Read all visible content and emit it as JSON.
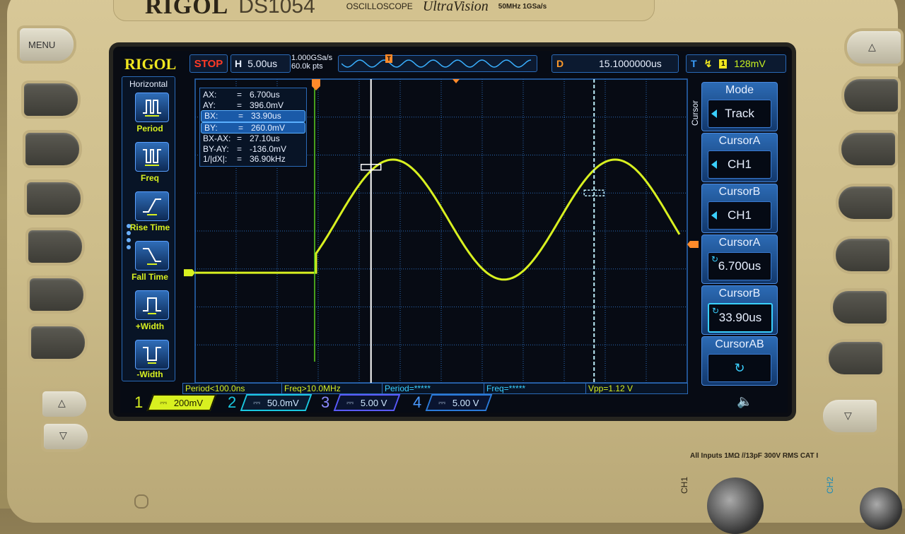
{
  "device": {
    "brand": "RIGOL",
    "model": "DS1054",
    "category_label": "OSCILLOSCOPE",
    "series": "UltraVision",
    "spec": "50MHz  1GSa/s",
    "input_spec": "All Inputs 1MΩ //13pF 300V RMS  CAT I",
    "menu_button_label": "MENU",
    "channel_connectors": [
      "CH1",
      "CH2"
    ]
  },
  "topbar": {
    "logo": "RIGOL",
    "run_state": "STOP",
    "horizontal_label": "H",
    "timebase": "5.00us",
    "sample_rate": "1.000GSa/s",
    "memory_depth": "60.0k pts",
    "trigger_marker": "T",
    "delay_label": "D",
    "delay_value": "15.1000000us",
    "trigger_label": "T",
    "trigger_edge": "rising-edge-icon",
    "trigger_source": "1",
    "trigger_level": "128mV"
  },
  "left_menu": {
    "title": "Horizontal",
    "items": [
      {
        "label": "Period",
        "icon": "period-icon"
      },
      {
        "label": "Freq",
        "icon": "frequency-icon"
      },
      {
        "label": "Rise Time",
        "icon": "rise-time-icon"
      },
      {
        "label": "Fall Time",
        "icon": "fall-time-icon"
      },
      {
        "label": "+Width",
        "icon": "positive-width-icon"
      },
      {
        "label": "-Width",
        "icon": "negative-width-icon"
      }
    ]
  },
  "cursor_readout": [
    {
      "key": "AX:",
      "value": "6.700us",
      "highlight": false
    },
    {
      "key": "AY:",
      "value": "396.0mV",
      "highlight": false
    },
    {
      "key": "BX:",
      "value": "33.90us",
      "highlight": true
    },
    {
      "key": "BY:",
      "value": "260.0mV",
      "highlight": true
    },
    {
      "key": "BX-AX:",
      "value": "27.10us",
      "highlight": false
    },
    {
      "key": "BY-AY:",
      "value": "-136.0mV",
      "highlight": false
    },
    {
      "key": "1/|dX|:",
      "value": "36.90kHz",
      "highlight": false
    }
  ],
  "right_menu": {
    "tab": "Cursor",
    "items": [
      {
        "title": "Mode",
        "value": "Track",
        "control": "select"
      },
      {
        "title": "CursorA",
        "value": "CH1",
        "control": "select"
      },
      {
        "title": "CursorB",
        "value": "CH1",
        "control": "select"
      },
      {
        "title": "CursorA",
        "value": "6.700us",
        "control": "knob"
      },
      {
        "title": "CursorB",
        "value": "33.90us",
        "control": "knob",
        "selected": true
      },
      {
        "title": "CursorAB",
        "value": "",
        "control": "knob"
      }
    ]
  },
  "measurements": [
    {
      "text": "Period<100.0ns",
      "color": "yellow"
    },
    {
      "text": "Freq>10.0MHz",
      "color": "yellow"
    },
    {
      "text": "Period=*****",
      "color": "cyan"
    },
    {
      "text": "Freq=*****",
      "color": "cyan"
    },
    {
      "text": "Vpp=1.12 V",
      "color": "yellow"
    }
  ],
  "channels": [
    {
      "num": "1",
      "coupling": "DC",
      "scale": "200mV",
      "color": "#d8f020",
      "active": true
    },
    {
      "num": "2",
      "coupling": "DC",
      "scale": "50.0mV",
      "color": "#1ac8e0",
      "active": false
    },
    {
      "num": "3",
      "coupling": "DC",
      "scale": "5.00 V",
      "color": "#5a5aff",
      "active": false
    },
    {
      "num": "4",
      "coupling": "DC",
      "scale": "5.00 V",
      "color": "#2a7ad8",
      "active": false
    }
  ],
  "waveform": {
    "channel": "1",
    "type": "damped sine burst after trigger",
    "trigger_time_us": 0,
    "volts_per_div": 0.2,
    "time_per_div_us": 5,
    "cursor_a_time_us": 6.7,
    "cursor_b_time_us": 33.9,
    "cursor_a_volts": 0.396,
    "cursor_b_volts": 0.26,
    "baseline_volts": -0.16
  },
  "colors": {
    "ch1": "#d8f020",
    "grid": "#2a6ab8",
    "accent": "#3ad0ff",
    "stop": "#ff3a26",
    "delay": "#ff9a2a"
  }
}
